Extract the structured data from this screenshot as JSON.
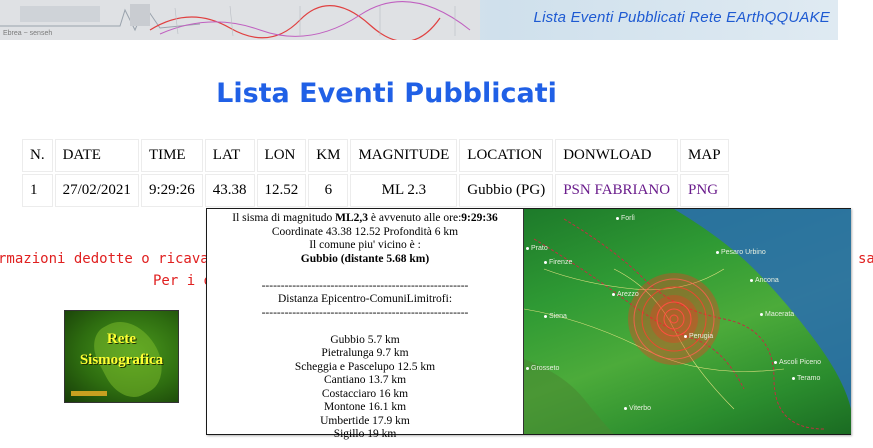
{
  "banner": {
    "title": "Lista Eventi Pubblicati Rete EArthQQUAKE",
    "slogan": "Ebrea ~ senseh"
  },
  "page_title": "Lista Eventi Pubblicati",
  "table": {
    "headers": [
      "N.",
      "DATE",
      "TIME",
      "LAT",
      "LON",
      "KM",
      "MAGNITUDE",
      "LOCATION",
      "DONWLOAD",
      "MAP"
    ],
    "rows": [
      {
        "n": "1",
        "date": "27/02/2021",
        "time": "9:29:26",
        "lat": "43.38",
        "lon": "12.52",
        "km": "6",
        "magnitude": "ML 2.3",
        "location": "Gubbio (PG)",
        "download": "PSN FABRIANO",
        "map": "PNG"
      }
    ]
  },
  "info": {
    "line1": "rmazioni dedotte o ricavate",
    "line1_right": "sa",
    "line2": "Per i do"
  },
  "logo": {
    "line1": "Rete",
    "line2": "Sismografica"
  },
  "popup": {
    "intro_before": "Il sisma di magnitudo ",
    "magnitude": "ML2,3",
    "intro_middle": " è avvenuto alle ore:",
    "time": "9:29:36",
    "coords_line": "Coordinate 43.38 12.52 Profondità 6 km",
    "nearest_label": "Il comune piu' vicino è :",
    "nearest_name": "Gubbio",
    "nearest_distance": "(distante 5.68 km)",
    "dash_line": "------------------------------------------------------",
    "distances_title": "Distanza Epicentro-ComuniLimitrofi:",
    "distances": [
      "Gubbio 5.7 km",
      "Pietralunga 9.7 km",
      "Scheggia e Pascelupo 12.5 km",
      "Cantiano 13.7 km",
      "Costacciaro 16 km",
      "Montone 16.1 km",
      "Umbertide 17.9 km",
      "Sigillo 19 km"
    ],
    "map_places": [
      "Forlì",
      "Prato",
      "Firenze",
      "Pesaro Urbino",
      "Arezzo",
      "Ancona",
      "Siena",
      "Macerata",
      "Grosseto",
      "Perugia",
      "Ascoli Piceno",
      "Teramo",
      "Viterbo"
    ]
  },
  "colors": {
    "title_blue": "#2060e6",
    "banner_title": "#1e5ad2",
    "info_red": "#e02020",
    "link_purple": "#6a1c8c"
  }
}
